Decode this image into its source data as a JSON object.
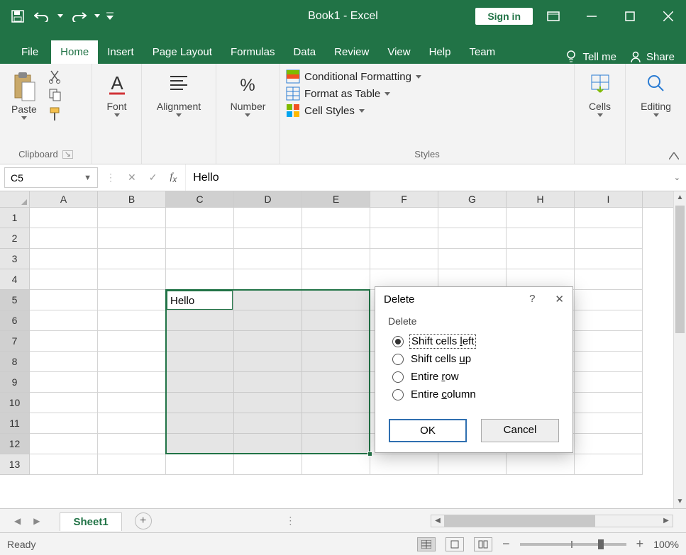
{
  "titlebar": {
    "title": "Book1  -  Excel",
    "sign_in": "Sign in"
  },
  "tabs": {
    "file": "File",
    "items": [
      "Home",
      "Insert",
      "Page Layout",
      "Formulas",
      "Data",
      "Review",
      "View",
      "Help",
      "Team"
    ],
    "active_index": 0,
    "tell_me": "Tell me",
    "share": "Share"
  },
  "ribbon": {
    "clipboard": {
      "paste": "Paste",
      "label": "Clipboard"
    },
    "font": {
      "btn": "Font",
      "label": ""
    },
    "alignment": {
      "btn": "Alignment",
      "label": ""
    },
    "number": {
      "btn": "Number",
      "label": ""
    },
    "styles": {
      "cond": "Conditional Formatting",
      "table": "Format as Table",
      "cell": "Cell Styles",
      "label": "Styles"
    },
    "cells": {
      "btn": "Cells",
      "label": ""
    },
    "editing": {
      "btn": "Editing",
      "label": ""
    }
  },
  "formula_bar": {
    "name_box": "C5",
    "formula": "Hello"
  },
  "grid": {
    "columns": [
      "A",
      "B",
      "C",
      "D",
      "E",
      "F",
      "G",
      "H",
      "I"
    ],
    "rows": [
      1,
      2,
      3,
      4,
      5,
      6,
      7,
      8,
      9,
      10,
      11,
      12,
      13
    ],
    "selected_cols": [
      "C",
      "D",
      "E"
    ],
    "selected_rows": [
      5,
      6,
      7,
      8,
      9,
      10,
      11,
      12
    ],
    "active_cell_value": "Hello"
  },
  "dialog": {
    "title": "Delete",
    "group": "Delete",
    "options": {
      "left": {
        "label": "Shift cells left",
        "underline": "l",
        "checked": true
      },
      "up": {
        "label": "Shift cells up",
        "underline": "u",
        "checked": false
      },
      "row": {
        "label": "Entire row",
        "underline": "r",
        "checked": false
      },
      "column": {
        "label": "Entire column",
        "underline": "c",
        "checked": false
      }
    },
    "ok": "OK",
    "cancel": "Cancel"
  },
  "sheet_bar": {
    "sheet": "Sheet1"
  },
  "status": {
    "ready": "Ready",
    "zoom": "100%"
  }
}
